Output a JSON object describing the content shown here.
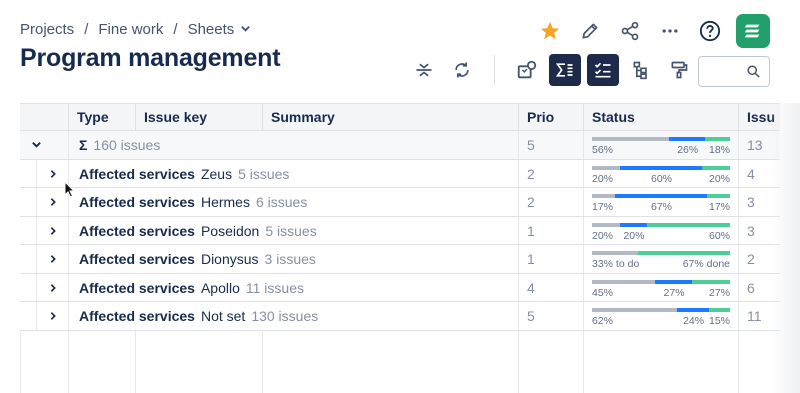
{
  "breadcrumb": {
    "items": [
      "Projects",
      "Fine work",
      "Sheets"
    ],
    "separator": "/"
  },
  "page": {
    "title": "Program management"
  },
  "colors": {
    "todo": "#b3b9c4",
    "in_progress": "#1d7afc",
    "done": "#4bce97",
    "star": "#f5a524",
    "logo": "#22a06b",
    "active_button": "#1d2a49"
  },
  "top_actions": [
    "star-icon",
    "pencil-icon",
    "share-icon",
    "more-icon",
    "help-icon",
    "app-logo-icon"
  ],
  "toolbar": [
    "collapse-expand-icon",
    "refresh-icon",
    "shapes-icon",
    "sum-columns-icon",
    "checklist-icon",
    "hierarchy-icon",
    "paint-roller-icon"
  ],
  "search": {
    "placeholder": "",
    "value": ""
  },
  "columns": [
    "Type",
    "Issue key",
    "Summary",
    "Prio",
    "Status",
    "Issu"
  ],
  "summary_row": {
    "symbol": "Σ",
    "label": "160 issues",
    "prio": "5",
    "status": {
      "todo": 56,
      "in_progress": 26,
      "done": 18,
      "labels": [
        "56%",
        "26%",
        "18%"
      ]
    },
    "issues": "13"
  },
  "rows": [
    {
      "label": "Affected services",
      "value": "Zeus",
      "count": "5 issues",
      "prio": "2",
      "status": {
        "todo": 20,
        "in_progress": 60,
        "done": 20,
        "labels": [
          "20%",
          "60%",
          "20%"
        ]
      },
      "issues": "4"
    },
    {
      "label": "Affected services",
      "value": "Hermes",
      "count": "6 issues",
      "prio": "2",
      "status": {
        "todo": 17,
        "in_progress": 67,
        "done": 17,
        "labels": [
          "17%",
          "67%",
          "17%"
        ]
      },
      "issues": "3"
    },
    {
      "label": "Affected services",
      "value": "Poseidon",
      "count": "5 issues",
      "prio": "1",
      "status": {
        "todo": 20,
        "in_progress": 20,
        "done": 60,
        "labels": [
          "20%",
          "20%",
          "60%"
        ]
      },
      "issues": "3"
    },
    {
      "label": "Affected services",
      "value": "Dionysus",
      "count": "3 issues",
      "prio": "1",
      "status": {
        "todo": 33,
        "in_progress": 0,
        "done": 67,
        "labels": [
          "33% to do",
          "",
          "67% done"
        ]
      },
      "issues": "2"
    },
    {
      "label": "Affected services",
      "value": "Apollo",
      "count": "11 issues",
      "prio": "4",
      "status": {
        "todo": 45,
        "in_progress": 27,
        "done": 27,
        "labels": [
          "45%",
          "27%",
          "27%"
        ]
      },
      "issues": "6"
    },
    {
      "label": "Affected services",
      "value": "Not set",
      "count": "130 issues",
      "prio": "5",
      "status": {
        "todo": 62,
        "in_progress": 24,
        "done": 15,
        "labels": [
          "62%",
          "24%",
          "15%"
        ]
      },
      "issues": "11"
    }
  ]
}
